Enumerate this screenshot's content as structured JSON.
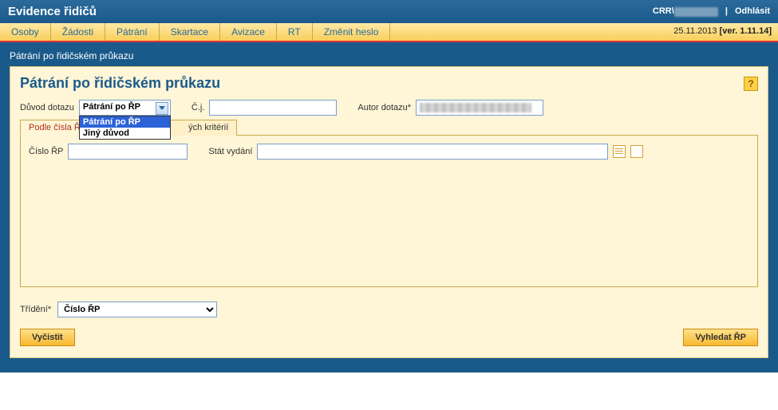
{
  "header": {
    "app_title": "Evidence řidičů",
    "user_prefix": "CRR\\",
    "logout": "Odhlásit"
  },
  "menu": {
    "items": [
      "Osoby",
      "Žádosti",
      "Pátrání",
      "Skartace",
      "Avizace",
      "RT",
      "Změnit heslo"
    ],
    "date": "25.11.2013",
    "version": "[ver. 1.11.14]"
  },
  "breadcrumb": "Pátrání po řidičském průkazu",
  "panel": {
    "title": "Pátrání po řidičském průkazu",
    "help": "?"
  },
  "form": {
    "reason_label": "Důvod dotazu",
    "reason_selected": "Pátrání po ŘP",
    "reason_options": [
      "Pátrání po ŘP",
      "Jiný důvod"
    ],
    "cj_label": "Č.j.",
    "author_label": "Autor dotazu*"
  },
  "tabs": {
    "tab1": "Podle čísla ŘP",
    "tab2_partial": "ých kritérií"
  },
  "tab_body": {
    "cislo_label": "Číslo ŘP",
    "stat_label": "Stát vydání"
  },
  "sort": {
    "label": "Třídění*",
    "selected": "Číslo ŘP"
  },
  "actions": {
    "clear": "Vyčistit",
    "search": "Vyhledat ŘP"
  }
}
